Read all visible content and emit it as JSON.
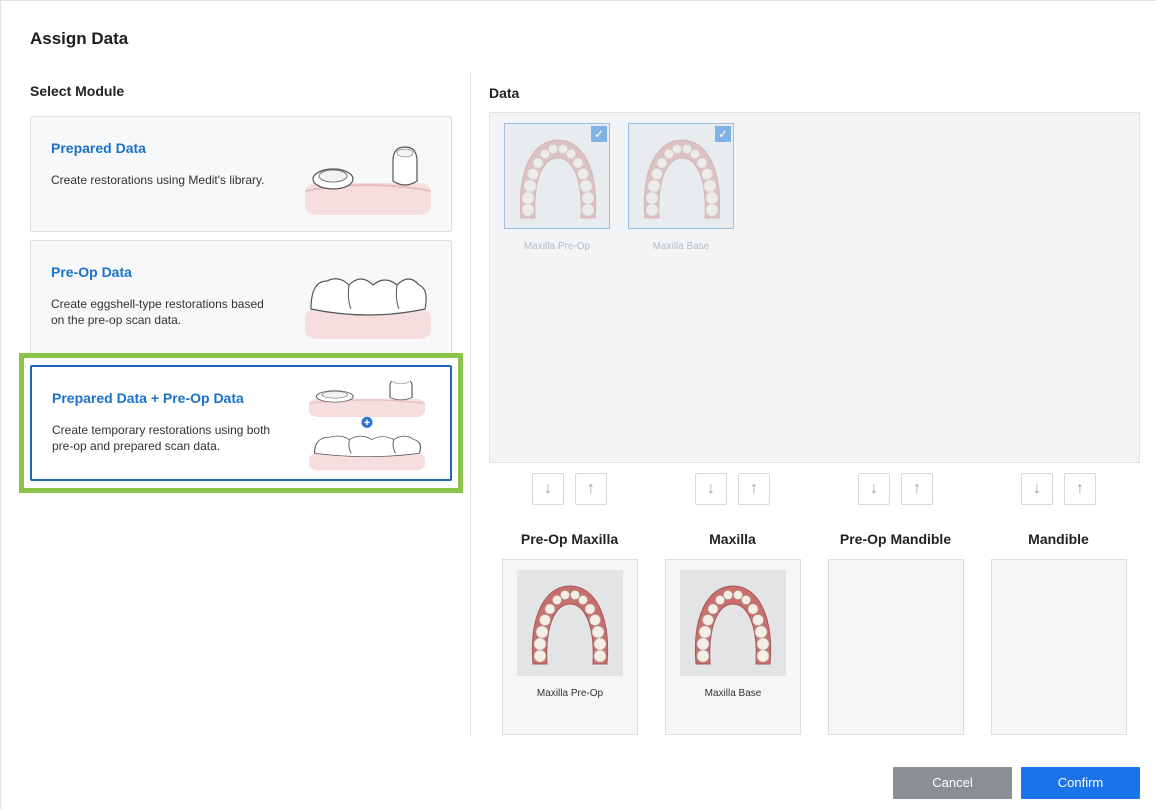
{
  "dialog": {
    "title": "Assign Data"
  },
  "left": {
    "heading": "Select Module",
    "modules": [
      {
        "title": "Prepared Data",
        "description": "Create restorations using Medit's library.",
        "selected": false
      },
      {
        "title": "Pre-Op Data",
        "description": "Create eggshell-type restorations based on the pre-op scan data.",
        "selected": false
      },
      {
        "title": "Prepared Data + Pre-Op Data",
        "description": "Create temporary restorations using both pre-op and prepared scan data.",
        "selected": true
      }
    ]
  },
  "right": {
    "heading": "Data",
    "pool": [
      {
        "label": "Maxilla Pre-Op",
        "checked": true
      },
      {
        "label": "Maxilla Base",
        "checked": true
      }
    ],
    "columns": [
      {
        "title": "Pre-Op Maxilla",
        "assigned": "Maxilla Pre-Op"
      },
      {
        "title": "Maxilla",
        "assigned": "Maxilla Base"
      },
      {
        "title": "Pre-Op Mandible",
        "assigned": null
      },
      {
        "title": "Mandible",
        "assigned": null
      }
    ],
    "arrow_icons": {
      "down": "↓",
      "up": "↑"
    }
  },
  "footer": {
    "cancel_label": "Cancel",
    "confirm_label": "Confirm"
  },
  "colors": {
    "accent": "#1a73c9",
    "selection_highlight": "#8bc34a",
    "confirm": "#1a73e8",
    "cancel": "#8a8f94"
  }
}
